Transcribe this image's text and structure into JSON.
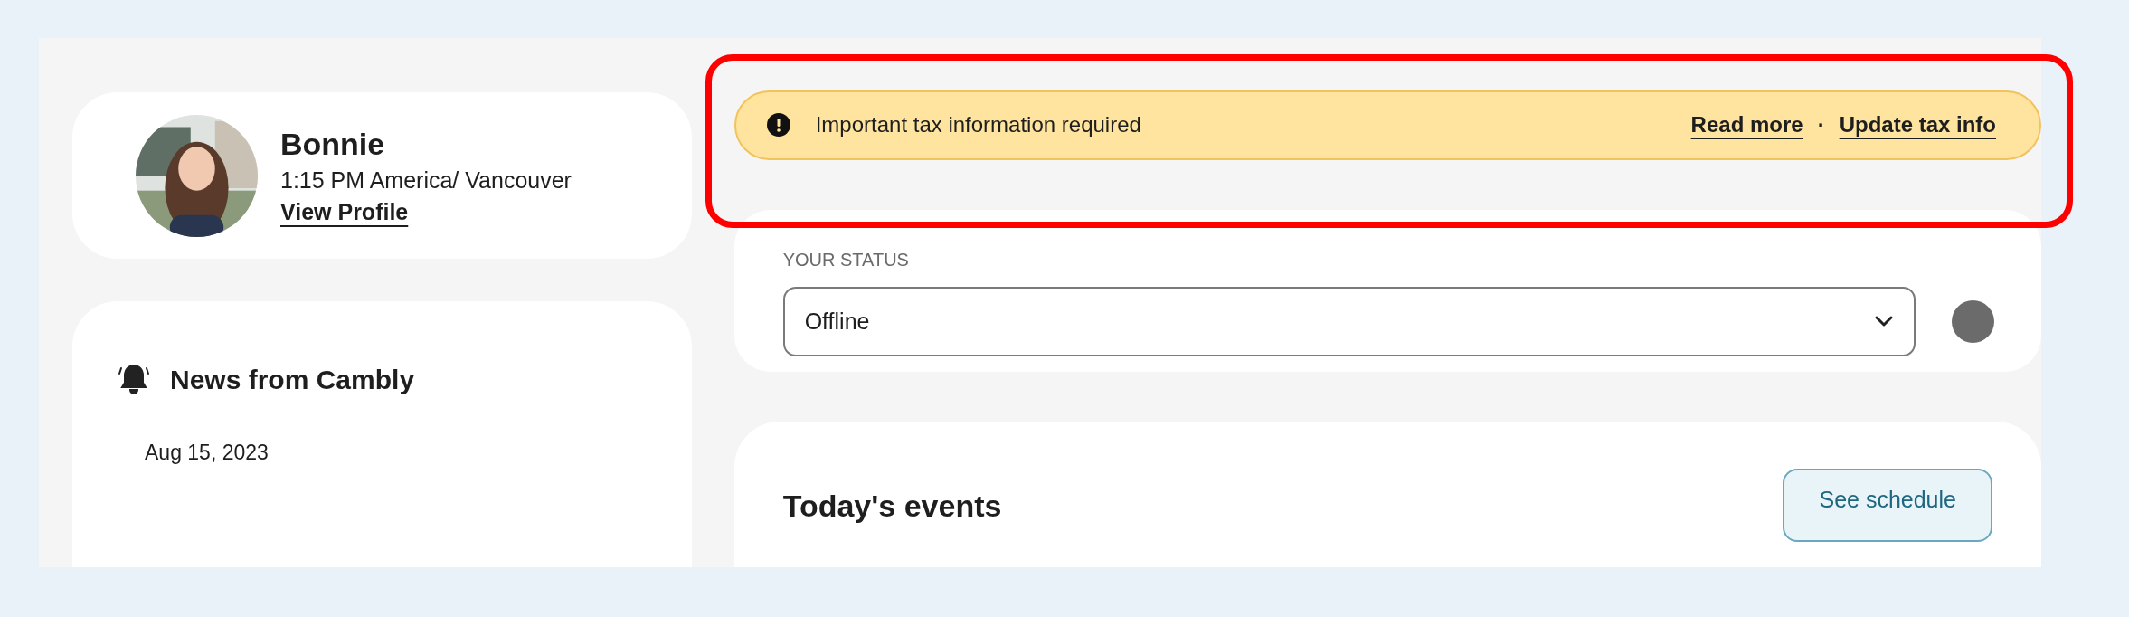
{
  "profile": {
    "name": "Bonnie",
    "local_time": "1:15 PM America/ Vancouver",
    "link": "View Profile"
  },
  "news": {
    "title": "News from Cambly",
    "date": "Aug 15, 2023"
  },
  "alert": {
    "message": "Important tax information required",
    "highlighted": true,
    "links": [
      {
        "label": "Read more"
      },
      {
        "label": "Update tax info"
      }
    ],
    "separator": "·"
  },
  "status": {
    "label": "YOUR STATUS",
    "value": "Offline"
  },
  "events": {
    "title": "Today's events",
    "button": "See schedule"
  }
}
